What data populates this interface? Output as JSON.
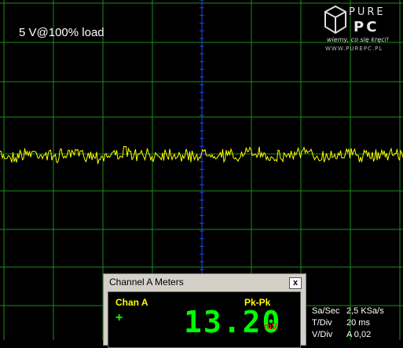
{
  "overlay_label": "5 V@100% load",
  "logo": {
    "word_top": "PURE",
    "word_bottom": "PC",
    "tagline": "wiemy, co się kręci!",
    "url": "WWW.PUREPC.PL"
  },
  "meter_window": {
    "title": "Channel A Meters",
    "close_label": "x",
    "channel_label": "Chan A",
    "measure_label": "Pk-Pk",
    "plus_label": "+",
    "reading": "13.20",
    "unit": "mV"
  },
  "settings": [
    {
      "key": "Sa/Sec",
      "value": "2,5 KSa/s"
    },
    {
      "key": "T/Div",
      "value": "20 ms"
    },
    {
      "key": "V/Div",
      "value": "A 0,02"
    }
  ],
  "colors": {
    "background": "#000000",
    "grid": "#1e8c1e",
    "trace": "#ffff00",
    "center_axis": "#2040ff",
    "digits": "#00ff00",
    "unit": "#ff2020"
  }
}
